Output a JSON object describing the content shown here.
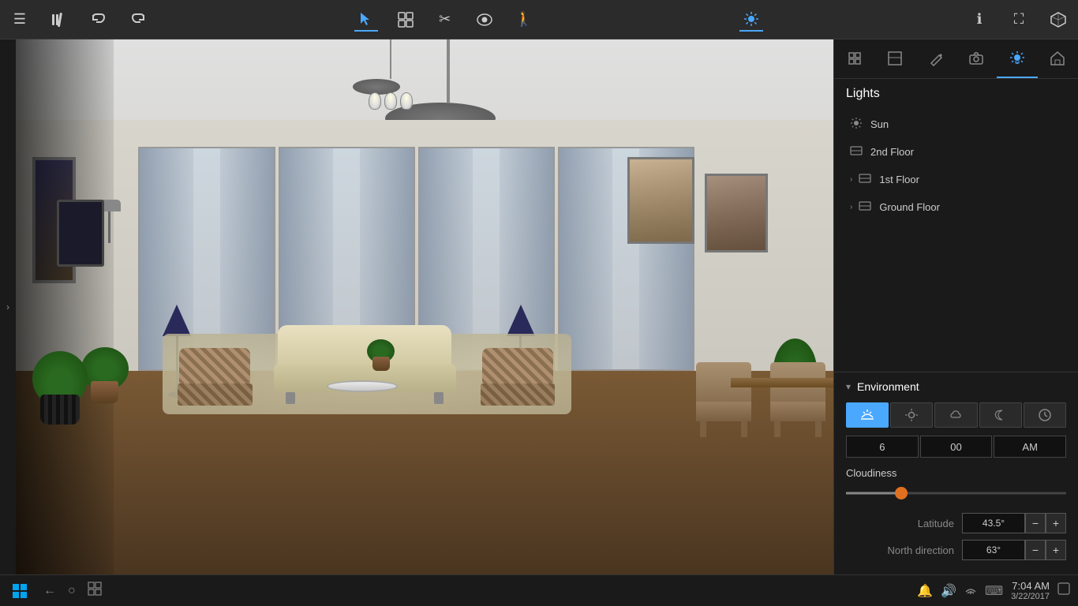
{
  "toolbar": {
    "icons": [
      {
        "name": "menu-icon",
        "symbol": "☰",
        "active": false
      },
      {
        "name": "library-icon",
        "symbol": "📚",
        "active": false
      },
      {
        "name": "undo-icon",
        "symbol": "↩",
        "active": false
      },
      {
        "name": "redo-icon",
        "symbol": "↪",
        "active": false
      },
      {
        "name": "select-icon",
        "symbol": "↖",
        "active": true
      },
      {
        "name": "grid-icon",
        "symbol": "⊞",
        "active": false
      },
      {
        "name": "scissors-icon",
        "symbol": "✂",
        "active": false
      },
      {
        "name": "eye-icon",
        "symbol": "👁",
        "active": false
      },
      {
        "name": "walk-icon",
        "symbol": "🚶",
        "active": false
      },
      {
        "name": "sun-toolbar-icon",
        "symbol": "☀",
        "active": true
      },
      {
        "name": "info-icon",
        "symbol": "ℹ",
        "active": false
      },
      {
        "name": "expand-icon",
        "symbol": "⛶",
        "active": false
      },
      {
        "name": "cube-icon",
        "symbol": "⬡",
        "active": false
      }
    ]
  },
  "right_panel": {
    "icons": [
      {
        "name": "tools-icon",
        "symbol": "🔧",
        "active": false
      },
      {
        "name": "layout-icon",
        "symbol": "⊟",
        "active": false
      },
      {
        "name": "paint-icon",
        "symbol": "✏",
        "active": false
      },
      {
        "name": "camera-icon",
        "symbol": "📷",
        "active": false
      },
      {
        "name": "light-icon",
        "symbol": "☀",
        "active": true
      },
      {
        "name": "house-icon",
        "symbol": "⌂",
        "active": false
      }
    ],
    "lights_title": "Lights",
    "light_items": [
      {
        "id": "sun",
        "label": "Sun",
        "icon": "☀",
        "expandable": false,
        "indent": 0
      },
      {
        "id": "2nd-floor",
        "label": "2nd Floor",
        "icon": "⊟",
        "expandable": false,
        "indent": 0
      },
      {
        "id": "1st-floor",
        "label": "1st Floor",
        "icon": "⊟",
        "expandable": true,
        "indent": 0
      },
      {
        "id": "ground-floor",
        "label": "Ground Floor",
        "icon": "⊟",
        "expandable": true,
        "indent": 0
      }
    ],
    "environment": {
      "title": "Environment",
      "time_buttons": [
        {
          "id": "sunrise",
          "symbol": "🌅",
          "active": true
        },
        {
          "id": "sunny",
          "symbol": "☀",
          "active": false
        },
        {
          "id": "cloudy",
          "symbol": "☁",
          "active": false
        },
        {
          "id": "night",
          "symbol": "☽",
          "active": false
        },
        {
          "id": "clock",
          "symbol": "🕐",
          "active": false
        }
      ],
      "time_hour": "6",
      "time_minute": "00",
      "time_period": "AM",
      "cloudiness_label": "Cloudiness",
      "cloudiness_value": 25,
      "latitude_label": "Latitude",
      "latitude_value": "43.5°",
      "north_direction_label": "North direction",
      "north_direction_value": "63°"
    }
  },
  "taskbar": {
    "clock_time": "7:04 AM",
    "clock_date": "3/22/2017",
    "system_icons": [
      "🔔",
      "🔊",
      "🔗",
      "⌨"
    ]
  },
  "left_nav": {
    "arrow": "›"
  }
}
